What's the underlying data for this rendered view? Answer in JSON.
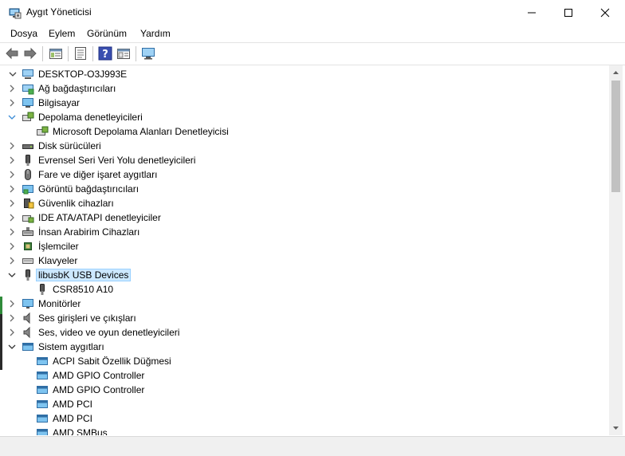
{
  "window": {
    "title": "Aygıt Yöneticisi",
    "icons": [
      "app-icon",
      "minimize-icon",
      "maximize-icon",
      "close-icon"
    ]
  },
  "menu": {
    "items": [
      "Dosya",
      "Eylem",
      "Görünüm",
      "Yardım"
    ]
  },
  "toolbar": {
    "buttons": [
      "back-icon",
      "forward-icon",
      "properties-pane-icon",
      "view-list-icon",
      "help-icon",
      "view-details-icon",
      "monitor-scan-icon"
    ]
  },
  "tree": {
    "root": "DESKTOP-O3J993E",
    "items": [
      {
        "label": "Ağ bağdaştırıcıları",
        "icon": "network-adapter-icon",
        "state": "collapsed",
        "level": 1
      },
      {
        "label": "Bilgisayar",
        "icon": "computer-icon",
        "state": "collapsed",
        "level": 1
      },
      {
        "label": "Depolama denetleyicileri",
        "icon": "storage-controller-icon",
        "state": "expanded",
        "level": 1
      },
      {
        "label": "Microsoft Depolama Alanları Denetleyicisi",
        "icon": "storage-controller-icon",
        "state": "leaf",
        "level": 2
      },
      {
        "label": "Disk sürücüleri",
        "icon": "disk-drive-icon",
        "state": "collapsed",
        "level": 1
      },
      {
        "label": "Evrensel Seri Veri Yolu denetleyicileri",
        "icon": "usb-icon",
        "state": "collapsed",
        "level": 1
      },
      {
        "label": "Fare ve diğer işaret aygıtları",
        "icon": "mouse-icon",
        "state": "collapsed",
        "level": 1
      },
      {
        "label": "Görüntü bağdaştırıcıları",
        "icon": "display-adapter-icon",
        "state": "collapsed",
        "level": 1
      },
      {
        "label": "Güvenlik cihazları",
        "icon": "security-device-icon",
        "state": "collapsed",
        "level": 1
      },
      {
        "label": "IDE ATA/ATAPI denetleyiciler",
        "icon": "ide-controller-icon",
        "state": "collapsed",
        "level": 1
      },
      {
        "label": "İnsan Arabirim Cihazları",
        "icon": "hid-icon",
        "state": "collapsed",
        "level": 1
      },
      {
        "label": "İşlemciler",
        "icon": "processor-icon",
        "state": "collapsed",
        "level": 1
      },
      {
        "label": "Klavyeler",
        "icon": "keyboard-icon",
        "state": "collapsed",
        "level": 1
      },
      {
        "label": "libusbK USB Devices",
        "icon": "usb-device-icon",
        "state": "expanded",
        "level": 1,
        "selected": true
      },
      {
        "label": "CSR8510 A10",
        "icon": "usb-device-icon",
        "state": "leaf",
        "level": 2
      },
      {
        "label": "Monitörler",
        "icon": "monitor-icon",
        "state": "collapsed",
        "level": 1
      },
      {
        "label": "Ses girişleri ve çıkışları",
        "icon": "speaker-icon",
        "state": "collapsed",
        "level": 1
      },
      {
        "label": "Ses, video ve oyun denetleyicileri",
        "icon": "speaker-icon",
        "state": "collapsed",
        "level": 1
      },
      {
        "label": "Sistem aygıtları",
        "icon": "system-device-icon",
        "state": "expanded",
        "level": 1
      },
      {
        "label": "ACPI Sabit Özellik Düğmesi",
        "icon": "system-device-icon",
        "state": "leaf",
        "level": 2
      },
      {
        "label": "AMD GPIO Controller",
        "icon": "system-device-icon",
        "state": "leaf",
        "level": 2
      },
      {
        "label": "AMD GPIO Controller",
        "icon": "system-device-icon",
        "state": "leaf",
        "level": 2
      },
      {
        "label": "AMD PCI",
        "icon": "system-device-icon",
        "state": "leaf",
        "level": 2
      },
      {
        "label": "AMD PCI",
        "icon": "system-device-icon",
        "state": "leaf",
        "level": 2
      },
      {
        "label": "AMD SMBus",
        "icon": "system-device-icon",
        "state": "leaf",
        "level": 2
      }
    ]
  },
  "colors": {
    "selection_bg": "#cce8ff",
    "selection_border": "#99d1ff",
    "chevron": "#6b6b6b",
    "expanded_chevron": "#3a8bd6",
    "scrollbar_thumb": "#c1c1c1"
  }
}
